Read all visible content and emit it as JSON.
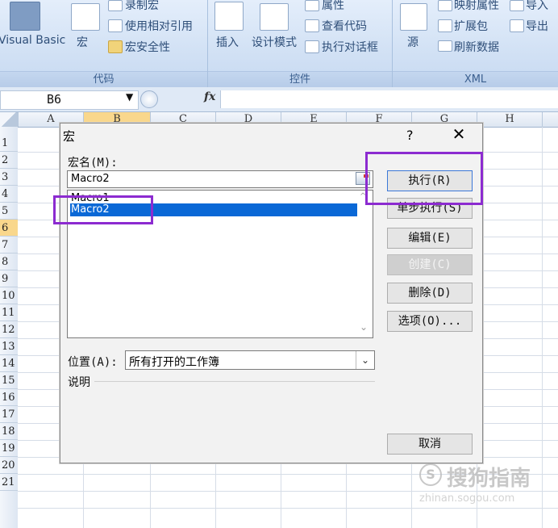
{
  "ribbon": {
    "code_group": {
      "label": "代码",
      "visual_basic": "Visual Basic",
      "macros": "宏",
      "record_macro": "录制宏",
      "relative_ref": "使用相对引用",
      "macro_security": "宏安全性"
    },
    "controls_group": {
      "label": "控件",
      "insert": "插入",
      "design_mode": "设计模式",
      "properties": "属性",
      "view_code": "查看代码",
      "run_dialog": "执行对话框"
    },
    "xml_group": {
      "label": "XML",
      "source": "源",
      "map_properties": "映射属性",
      "expansion_packs": "扩展包",
      "refresh_data": "刷新数据",
      "import": "导入",
      "export": "导出"
    }
  },
  "formula_bar": {
    "name_box": "B6",
    "fx": "fx"
  },
  "grid": {
    "columns": [
      "A",
      "B",
      "C",
      "D",
      "E",
      "F",
      "G",
      "H"
    ],
    "rows": [
      "1",
      "2",
      "3",
      "4",
      "5",
      "6",
      "7",
      "8",
      "9",
      "10",
      "11",
      "12",
      "13",
      "14",
      "15",
      "16",
      "17",
      "18",
      "19",
      "20",
      "21"
    ],
    "selected_row": "6"
  },
  "dialog": {
    "title": "宏",
    "help": "?",
    "close": "✕",
    "macro_name_label": "宏名(M):",
    "macro_name_value": "Macro2",
    "macros": [
      "Macro1",
      "Macro2"
    ],
    "selected_macro": "Macro2",
    "buttons": {
      "run": "执行(R)",
      "step_into": "单步执行(S)",
      "edit": "编辑(E)",
      "create": "创建(C)",
      "delete": "删除(D)",
      "options": "选项(O)...",
      "cancel": "取消"
    },
    "location_label": "位置(A):",
    "location_value": "所有打开的工作簿",
    "description_label": "说明"
  },
  "watermark": {
    "brand": "搜狗指南",
    "url": "zhinan.sogou.com"
  },
  "colors": {
    "highlight": "#8c2bd0",
    "selection": "#0a68d6",
    "ribbon": "#d3e2f5"
  }
}
